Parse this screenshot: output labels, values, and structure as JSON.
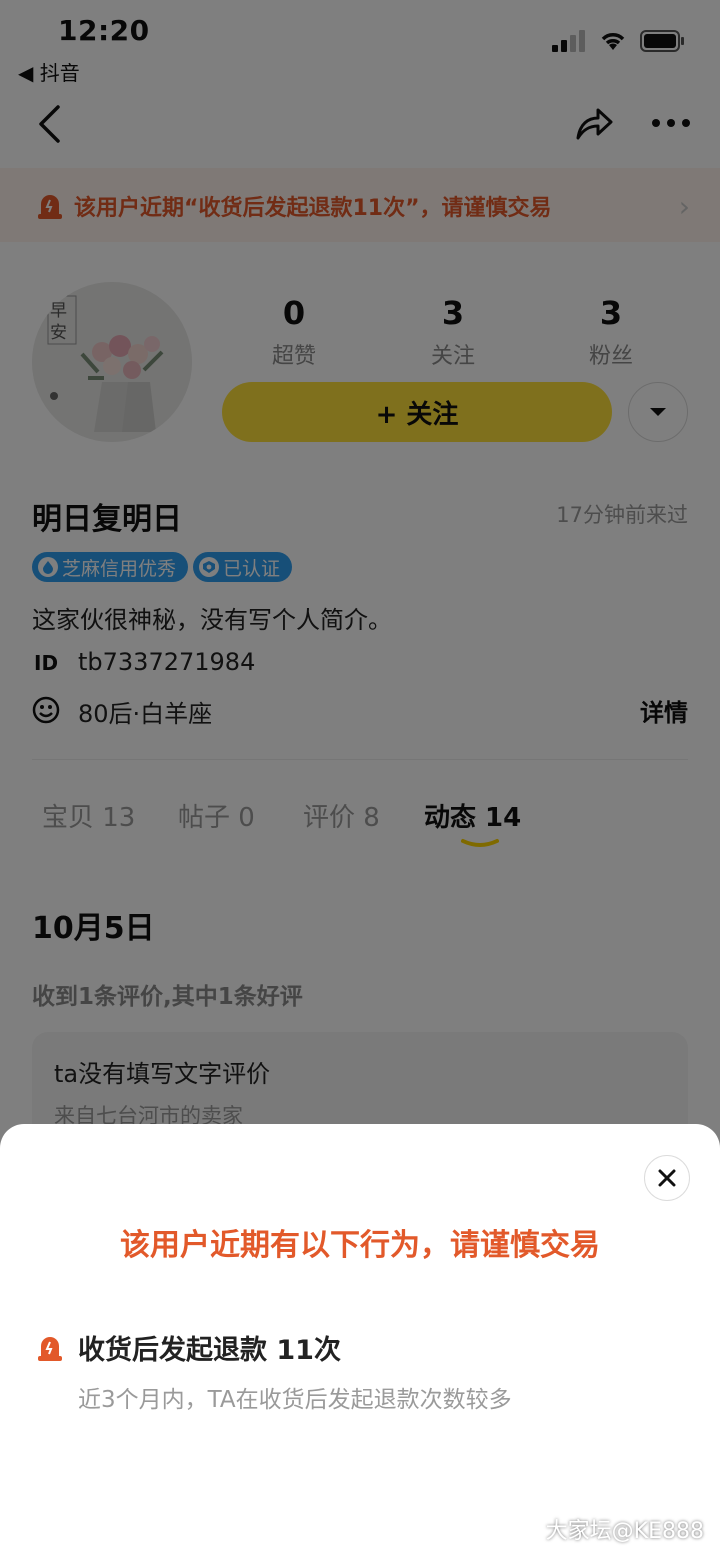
{
  "status_bar": {
    "time": "12:20",
    "back_app": "◀ 抖音"
  },
  "warning_banner": {
    "text": "该用户近期“收货后发起退款11次”，请谨慎交易"
  },
  "avatar": {
    "text1": "早",
    "text2": "安"
  },
  "stats": [
    {
      "value": "0",
      "label": "超赞"
    },
    {
      "value": "3",
      "label": "关注"
    },
    {
      "value": "3",
      "label": "粉丝"
    }
  ],
  "follow_button": {
    "label": "+ 关注"
  },
  "profile": {
    "name": "明日复明日",
    "last_seen": "17分钟前来过",
    "badges": [
      "芝麻信用优秀",
      "已认证"
    ],
    "bio": "这家伙很神秘，没有写个人简介。",
    "id_label": "ID",
    "id_value": "tb7337271984",
    "info": "80后·白羊座",
    "detail_label": "详情"
  },
  "tabs": [
    {
      "label": "宝贝 13"
    },
    {
      "label": "帖子 0"
    },
    {
      "label": "评价 8"
    },
    {
      "label": "动态 14",
      "active": true
    }
  ],
  "feed": {
    "date": "10月5日",
    "summary": "收到1条评价,其中1条好评",
    "card_title": "ta没有填写文字评价",
    "card_sub": "来自七台河市的卖家"
  },
  "sheet": {
    "title": "该用户近期有以下行为，请谨慎交易",
    "item_title": "收货后发起退款 11次",
    "item_desc": "近3个月内，TA在收货后发起退款次数较多"
  },
  "watermark": "大家坛@KE888",
  "colors": {
    "accent": "#ffe03a",
    "warning": "#e2592a",
    "badge": "#2f9ef0"
  }
}
